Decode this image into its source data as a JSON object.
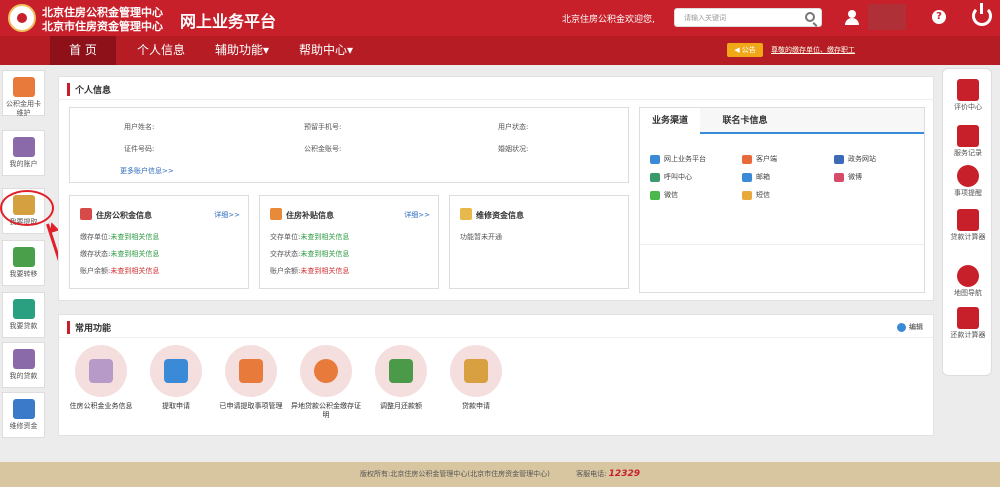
{
  "header": {
    "org_line1": "北京住房公积金管理中心",
    "org_line2": "北京市住房资金管理中心",
    "platform_title": "网上业务平台",
    "welcome": "北京住房公积金欢迎您,",
    "search_placeholder": "请输入关键词",
    "help_label": "?"
  },
  "nav": {
    "items": [
      "首 页",
      "个人信息",
      "辅助功能▾",
      "帮助中心▾"
    ],
    "notice_label": "◀ 公告",
    "notice_text": "尊敬的缴存单位、缴存职工"
  },
  "left_sidebar": [
    {
      "label": "公积金用卡维护",
      "icon": "id-card-icon",
      "color": "#e87a3c"
    },
    {
      "label": "我的账户",
      "icon": "users-icon",
      "color": "#8a6aa8"
    },
    {
      "label": "我要提取",
      "icon": "coins-icon",
      "color": "#d4a040"
    },
    {
      "label": "我要转移",
      "icon": "transfer-tag-icon",
      "color": "#4aa04a"
    },
    {
      "label": "我要贷款",
      "icon": "money-icon",
      "color": "#2aa080"
    },
    {
      "label": "我的贷款",
      "icon": "house-icon",
      "color": "#8a6aa8"
    },
    {
      "label": "维修资金",
      "icon": "edit-icon",
      "color": "#3a7ac8"
    }
  ],
  "personal_info": {
    "title": "个人信息",
    "fields": [
      "用户姓名:",
      "预留手机号:",
      "用户状态:",
      "证件号码:",
      "公积金账号:",
      "婚姻状况:"
    ],
    "more": "更多账户信息>>"
  },
  "info_boxes": [
    {
      "title": "住房公积金信息",
      "more": "详细>>",
      "icon_color": "#d84a4a",
      "rows": [
        {
          "k": "缴存单位:",
          "v": "未查到相关信息",
          "c": "g"
        },
        {
          "k": "缴存状态:",
          "v": "未查到相关信息",
          "c": "g"
        },
        {
          "k": "账户余额:",
          "v": "未查到相关信息",
          "c": "r"
        }
      ]
    },
    {
      "title": "住房补贴信息",
      "more": "详细>>",
      "icon_color": "#e88a3a",
      "rows": [
        {
          "k": "交存单位:",
          "v": "未查到相关信息",
          "c": "g"
        },
        {
          "k": "交存状态:",
          "v": "未查到相关信息",
          "c": "g"
        },
        {
          "k": "账户余额:",
          "v": "未查到相关信息",
          "c": "r"
        }
      ]
    },
    {
      "title": "维修资金信息",
      "more": "",
      "icon_color": "#e8b84a",
      "rows": [
        {
          "k": "",
          "v": "功能暂未开通",
          "c": "b"
        }
      ]
    }
  ],
  "channels": {
    "tab_active": "业务渠道",
    "tab_other": "联名卡信息",
    "items": [
      {
        "label": "网上业务平台",
        "color": "#3a8ad8"
      },
      {
        "label": "客户端",
        "color": "#e86a3a"
      },
      {
        "label": "政务网站",
        "color": "#3a6ab8"
      },
      {
        "label": "呼叫中心",
        "color": "#3a9a6a"
      },
      {
        "label": "邮箱",
        "color": "#3a8ad8"
      },
      {
        "label": "微博",
        "color": "#d84a6a"
      },
      {
        "label": "微信",
        "color": "#4ab84a"
      },
      {
        "label": "短信",
        "color": "#e8a83a"
      }
    ]
  },
  "common_functions": {
    "title": "常用功能",
    "edit_label": "编辑",
    "items": [
      {
        "label": "住房公积金业务信息",
        "color": "#b89ac8"
      },
      {
        "label": "提取申请",
        "color": "#3a8ad8"
      },
      {
        "label": "已申请提取事项管理",
        "color": "#e87a3c"
      },
      {
        "label": "异地贷款公积金缴存证明",
        "color": "#e87a3c"
      },
      {
        "label": "调整月还款额",
        "color": "#4a9a4a"
      },
      {
        "label": "贷款申请",
        "color": "#d8a040"
      }
    ]
  },
  "right_sidebar": [
    "评价中心",
    "服务记录",
    "事项提醒",
    "贷款计算器",
    "地图导航",
    "还款计算器"
  ],
  "footer": {
    "copyright": "版权所有:北京住房公积金管理中心(北京市住房资金管理中心)",
    "tel_label": "客服电话:",
    "tel": "12329"
  }
}
